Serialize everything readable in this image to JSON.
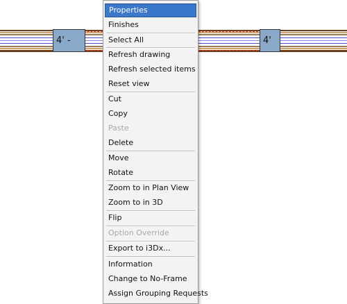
{
  "drawing": {
    "dimension_left": "4' -",
    "dimension_right": "4'"
  },
  "context_menu": {
    "items": [
      {
        "label": "Properties"
      },
      {
        "label": "Finishes"
      },
      {
        "label": "Select All"
      },
      {
        "label": "Refresh drawing"
      },
      {
        "label": "Refresh selected items"
      },
      {
        "label": "Reset view"
      },
      {
        "label": "Cut"
      },
      {
        "label": "Copy"
      },
      {
        "label": "Paste"
      },
      {
        "label": "Delete"
      },
      {
        "label": "Move"
      },
      {
        "label": "Rotate"
      },
      {
        "label": "Zoom to in Plan View"
      },
      {
        "label": "Zoom to in 3D"
      },
      {
        "label": "Flip"
      },
      {
        "label": "Option Override"
      },
      {
        "label": "Export to i3Dx..."
      },
      {
        "label": "Information"
      },
      {
        "label": "Change to No-Frame"
      },
      {
        "label": "Assign Grouping Requests"
      }
    ],
    "selected_item": "Properties",
    "disabled_items": [
      "Paste",
      "Option Override"
    ]
  },
  "colors": {
    "selection": "#3b78c9",
    "menu_background": "#f3f3f3",
    "disabled_text": "#a9a9a9",
    "dimension_box": "#8aa8c8",
    "wall_brown": "#7a4a22",
    "wall_blue": "#5a5ad0"
  }
}
